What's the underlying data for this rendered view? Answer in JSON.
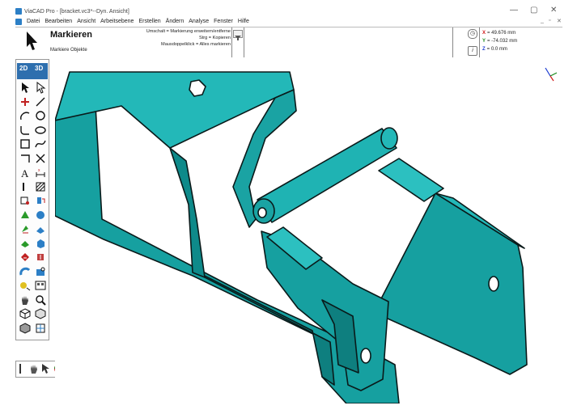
{
  "window": {
    "title": "ViaCAD Pro - [bracket.vc3*--Dyn. Ansicht]",
    "controls": [
      "—",
      "▢",
      "✕"
    ]
  },
  "menu": {
    "items": [
      "Datei",
      "Bearbeiten",
      "Ansicht",
      "Arbeitsebene",
      "Erstellen",
      "Ändern",
      "Analyse",
      "Fenster",
      "Hilfe"
    ],
    "mdi_controls": [
      "_",
      "▫",
      "✕"
    ]
  },
  "tool": {
    "name": "Markieren",
    "sub": "Markiere Objekte",
    "hints": [
      "Umschalt = Markierung erweitern/entferne",
      "Strg = Kopieren",
      "Mausdoppelklick = Alles markieren"
    ]
  },
  "coordinates": {
    "x_label": "X",
    "x_value": "= 49.676 mm",
    "y_label": "Y",
    "y_value": "= -74.032 mm",
    "z_label": "Z",
    "z_value": "= 0.0 mm",
    "info_icon": "i"
  },
  "palette": {
    "mode_2d": "2D",
    "mode_3d": "3D"
  },
  "colors": {
    "model_face": "#1aa3a3",
    "model_top": "#23b8b8",
    "model_dark": "#0e7f7f",
    "edge": "#0a1a1a",
    "palette_header": "#2e6fae"
  },
  "icons": [
    "select-arrow-icon",
    "line-icon",
    "circle-icon",
    "arc-icon",
    "rectangle-icon",
    "spline-icon",
    "text-icon",
    "dimension-icon",
    "hatch-icon",
    "solid-icon",
    "sphere-icon",
    "extrude-icon",
    "pan-icon",
    "zoom-icon",
    "view-cube-icon",
    "triad-icon"
  ]
}
